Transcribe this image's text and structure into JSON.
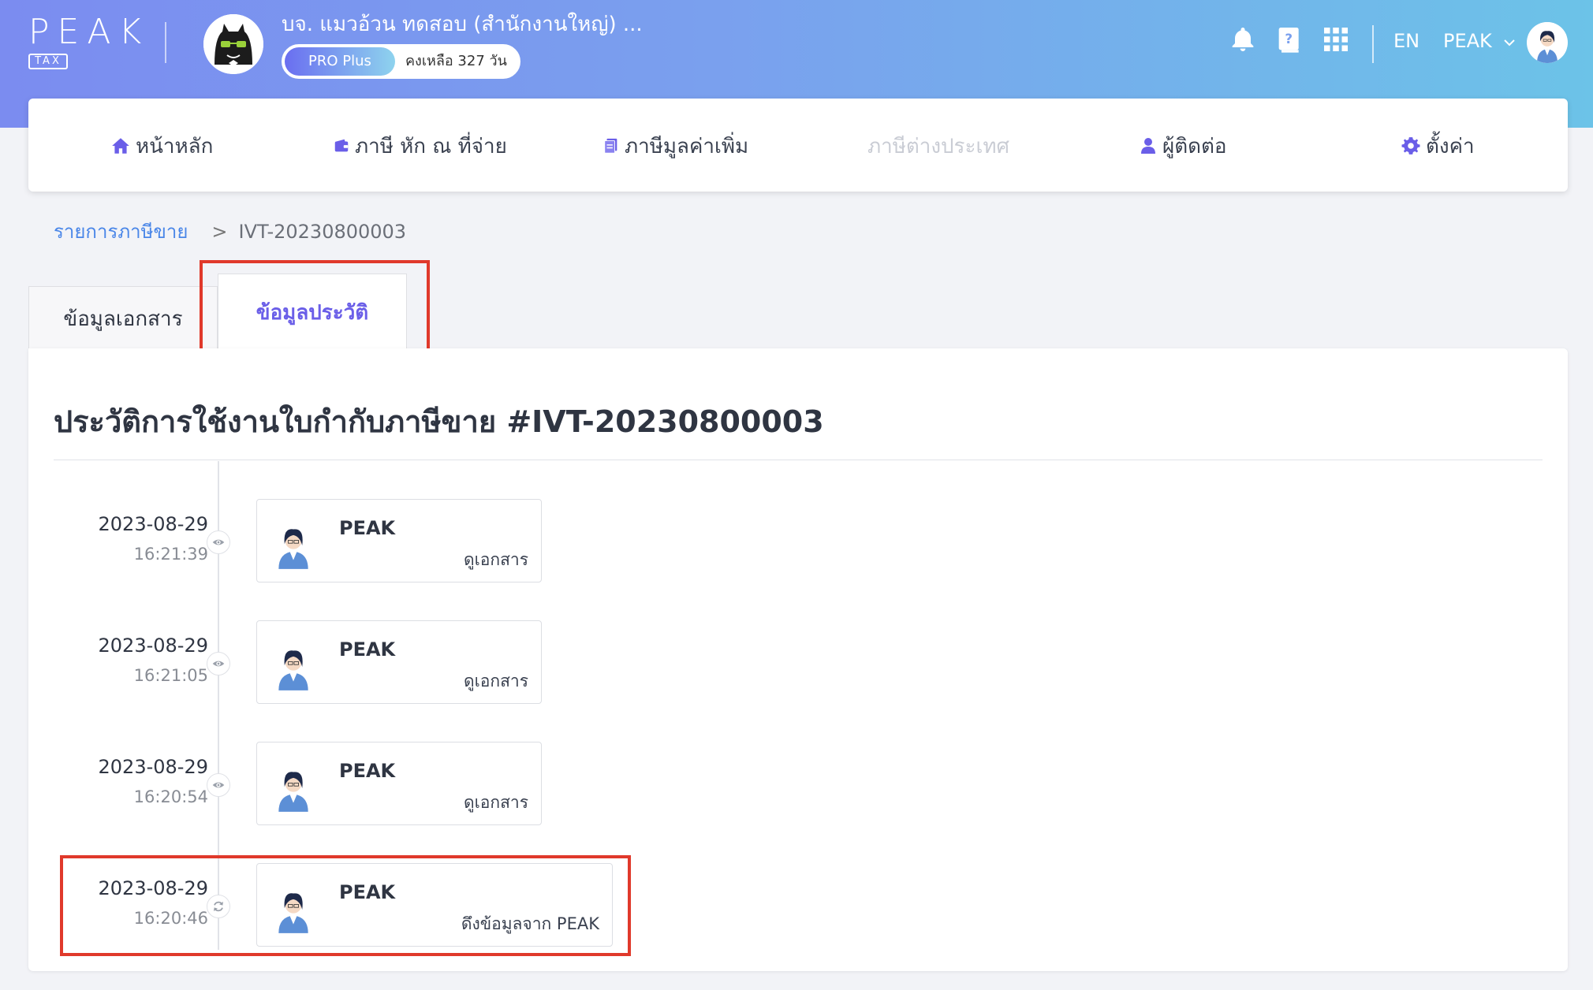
{
  "brand": {
    "logo_word": "PEAK",
    "logo_sub": "TAX"
  },
  "company": {
    "name": "บจ. แมวอ้วน ทดสอบ (สำนักงานใหญ่) ...",
    "plan": "PRO Plus",
    "remaining": "คงเหลือ 327 วัน"
  },
  "topbar": {
    "lang": "EN",
    "user": "PEAK"
  },
  "nav": {
    "items": [
      {
        "label": "หน้าหลัก",
        "icon": "home-icon"
      },
      {
        "label": "ภาษี หัก ณ ที่จ่าย",
        "icon": "wallet-icon"
      },
      {
        "label": "ภาษีมูลค่าเพิ่ม",
        "icon": "document-icon"
      },
      {
        "label": "ภาษีต่างประเทศ",
        "icon": ""
      },
      {
        "label": "ผู้ติดต่อ",
        "icon": "person-icon"
      },
      {
        "label": "ตั้งค่า",
        "icon": "gear-icon"
      }
    ]
  },
  "breadcrumb": {
    "parent": "รายการภาษีขาย",
    "separator": ">",
    "current": "IVT-20230800003"
  },
  "tabs": [
    {
      "label": "ข้อมูลเอกสาร"
    },
    {
      "label": "ข้อมูลประวัติ"
    }
  ],
  "history": {
    "title": "ประวัติการใช้งานใบกำกับภาษีขาย #IVT-20230800003",
    "entries": [
      {
        "date": "2023-08-29",
        "time": "16:21:39",
        "user": "PEAK",
        "action": "ดูเอกสาร",
        "icon": "eye-icon"
      },
      {
        "date": "2023-08-29",
        "time": "16:21:05",
        "user": "PEAK",
        "action": "ดูเอกสาร",
        "icon": "eye-icon"
      },
      {
        "date": "2023-08-29",
        "time": "16:20:54",
        "user": "PEAK",
        "action": "ดูเอกสาร",
        "icon": "eye-icon"
      },
      {
        "date": "2023-08-29",
        "time": "16:20:46",
        "user": "PEAK",
        "action": "ดึงข้อมูลจาก PEAK",
        "icon": "sync-icon"
      }
    ]
  },
  "colors": {
    "accent": "#6a5ee8",
    "link": "#4a86e8",
    "highlight": "#e0392b"
  }
}
